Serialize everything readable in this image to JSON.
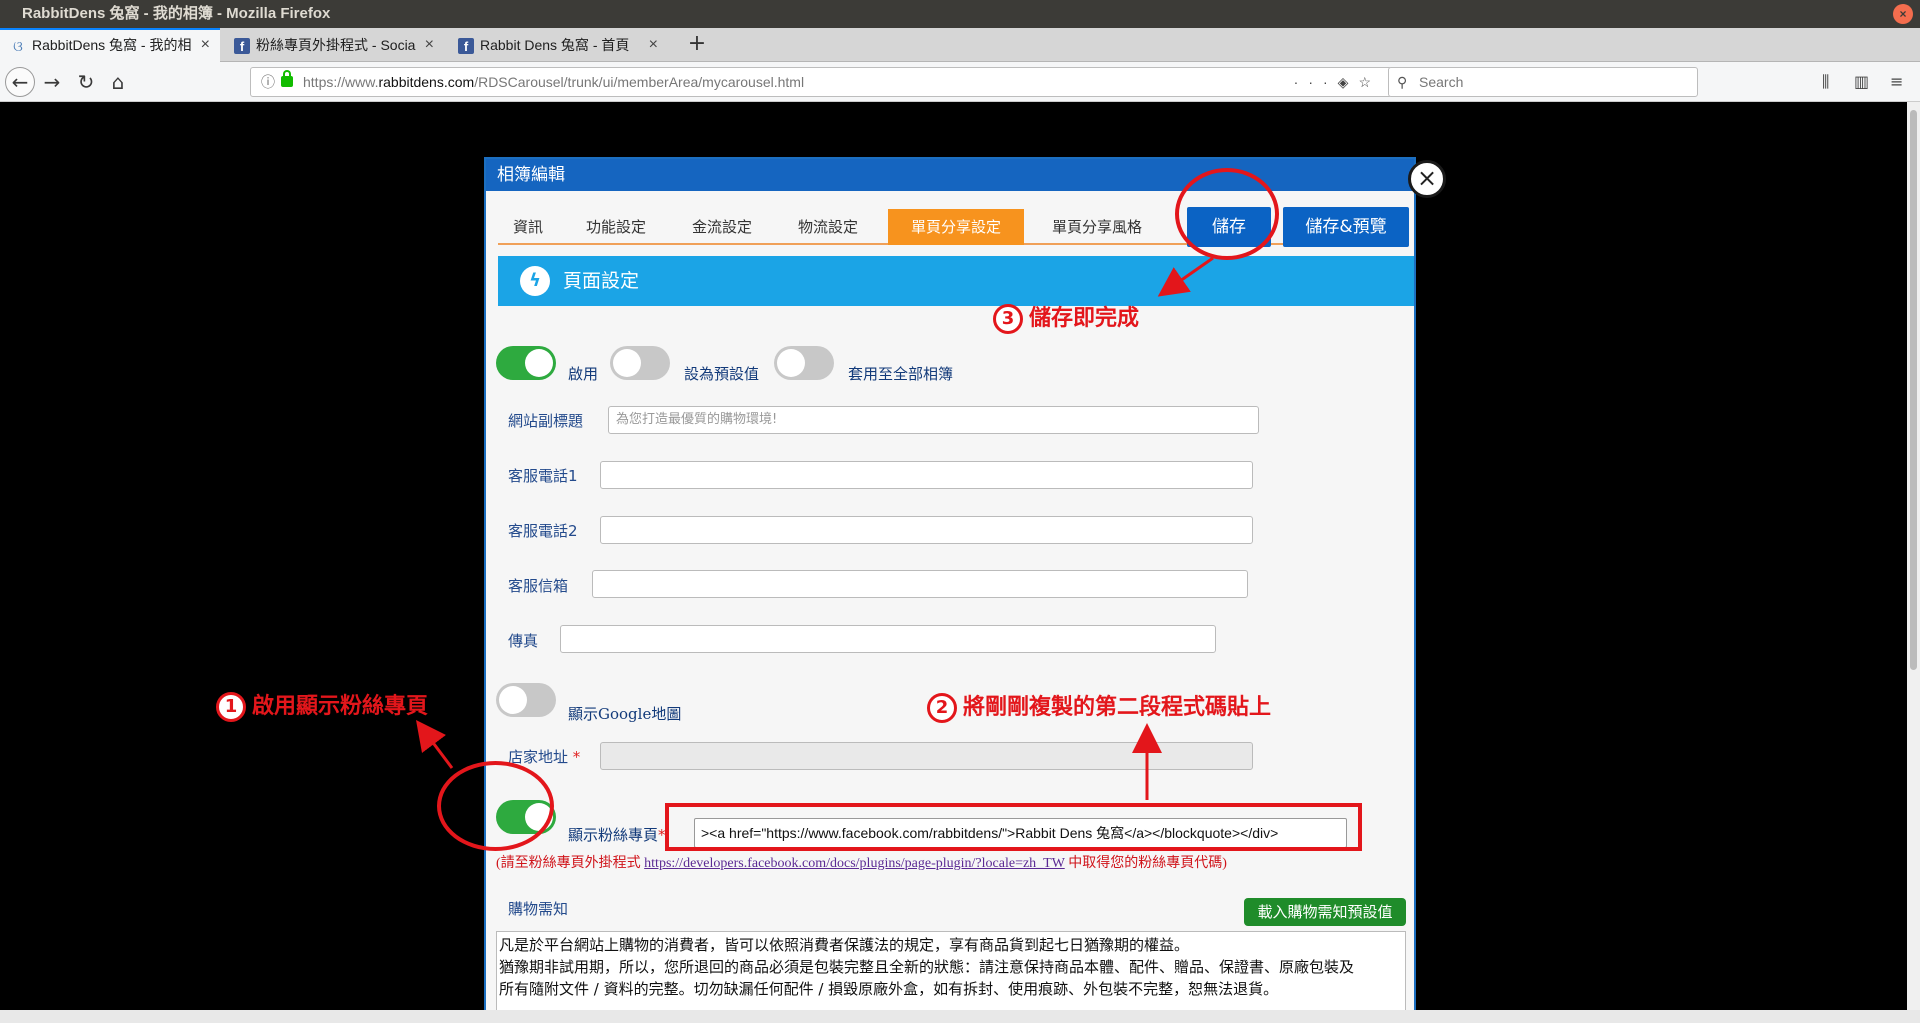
{
  "window": {
    "title": "RabbitDens 兔窩 - 我的相簿 - Mozilla Firefox"
  },
  "browser": {
    "tabs": [
      {
        "label": "RabbitDens 兔窩 - 我的相",
        "icon": "rabbit-icon",
        "active": true
      },
      {
        "label": "粉絲專頁外掛程式 - Socia",
        "icon": "facebook-icon",
        "active": false
      },
      {
        "label": "Rabbit Dens 兔窩 - 首頁",
        "icon": "facebook-icon",
        "active": false
      }
    ],
    "url_prefix": "https://www.",
    "url_host": "rabbitdens.com",
    "url_path": "/RDSCarousel/trunk/ui/memberArea/mycarousel.html",
    "search_placeholder": "Search"
  },
  "modal": {
    "title": "相簿編輯",
    "tabs": [
      "資訊",
      "功能設定",
      "金流設定",
      "物流設定",
      "單頁分享設定",
      "單頁分享風格"
    ],
    "active_tab": "單頁分享設定",
    "save_label": "儲存",
    "save_preview_label": "儲存&預覽",
    "section_title": "頁面設定",
    "toggles": [
      {
        "label": "啟用",
        "on": true
      },
      {
        "label": "設為預設值",
        "on": false
      },
      {
        "label": "套用至全部相簿",
        "on": false
      }
    ],
    "fields": [
      {
        "label": "網站副標題",
        "placeholder": "為您打造最優質的購物環境!"
      },
      {
        "label": "客服電話1",
        "placeholder": ""
      },
      {
        "label": "客服電話2",
        "placeholder": ""
      },
      {
        "label": "客服信箱",
        "placeholder": ""
      },
      {
        "label": "傳真",
        "placeholder": ""
      }
    ],
    "google_map_toggle": {
      "label": "顯示Google地圖",
      "on": false
    },
    "store_address_label": "店家地址",
    "fanpage_toggle": {
      "label": "顯示粉絲專頁",
      "on": true
    },
    "fanpage_code_value": "><a href=\"https://www.facebook.com/rabbitdens/\">Rabbit Dens 兔窩</a></blockquote></div>",
    "hint_before": "(請至粉絲專頁外掛程式 ",
    "hint_link": "https://developers.facebook.com/docs/plugins/page-plugin/?locale=zh_TW",
    "hint_after": " 中取得您的粉絲專頁代碼)",
    "shopping_notice_label": "購物需知",
    "load_default_button": "載入購物需知預設值",
    "shopping_notice_text": [
      "凡是於平台網站上購物的消費者，皆可以依照消費者保護法的規定，享有商品貨到起七日猶豫期的權益。",
      "猶豫期非試用期，所以，您所退回的商品必須是包裝完整且全新的狀態：請注意保持商品本體、配件、贈品、保證書、原廠包裝及",
      "所有隨附文件 / 資料的完整。切勿缺漏任何配件 / 損毀原廠外盒，如有拆封、使用痕跡、外包裝不完整，恕無法退貨。"
    ]
  },
  "annotations": {
    "step1_num": "1",
    "step1": "啟用顯示粉絲專頁",
    "step2_num": "2",
    "step2": "將剛剛複製的第二段程式碼貼上",
    "step3_num": "3",
    "step3": "儲存即完成"
  },
  "colors": {
    "accent_tab": "#f7931e",
    "button_blue": "#0b63c4",
    "section_blue": "#1ba4e6",
    "toggle_on": "#2eaa3f",
    "annotation_red": "#e3161b"
  }
}
